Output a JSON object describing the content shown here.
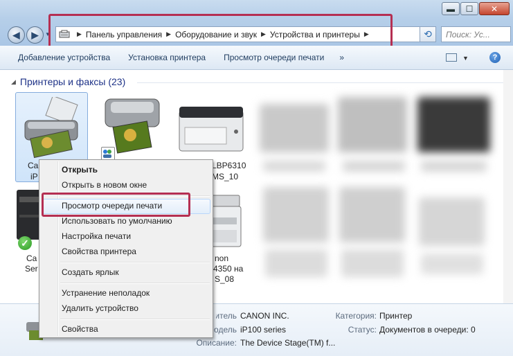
{
  "window": {
    "controls": {
      "minimize": "▬",
      "maximize": "☐",
      "close": "✕"
    }
  },
  "nav": {
    "back_icon": "back-arrow-icon",
    "forward_icon": "forward-arrow-icon"
  },
  "address": {
    "crumbs": [
      "Панель управления",
      "Оборудование и звук",
      "Устройства и принтеры"
    ],
    "dropdown": "▾",
    "refresh": "⟲"
  },
  "search": {
    "placeholder": "Поиск: Ус..."
  },
  "toolbar": {
    "items": [
      "Добавление устройства",
      "Установка принтера",
      "Просмотр очереди печати"
    ],
    "more": "»",
    "view_icon": "view-options-icon",
    "help": "?"
  },
  "section": {
    "title": "Принтеры и факсы (23)"
  },
  "devices": {
    "d1_label_a": "Ca",
    "d1_label_b": "iP",
    "d3_label_a": "LBP6310",
    "d3_label_b": "MS_10",
    "d4_label_a": "Ca",
    "d4_label_b": "Ser",
    "d5_label_a": "non",
    "d5_label_b": "4350 на",
    "d5_label_c": "S_08"
  },
  "context_menu": {
    "open": "Открыть",
    "open_new_window": "Открыть в новом окне",
    "view_queue": "Просмотр очереди печати",
    "set_default": "Использовать по умолчанию",
    "print_settings": "Настройка печати",
    "printer_properties": "Свойства принтера",
    "create_shortcut": "Создать ярлык",
    "troubleshoot": "Устранение неполадок",
    "remove_device": "Удалить устройство",
    "properties": "Свойства"
  },
  "details": {
    "manufacturer_key": "зводитель:",
    "manufacturer_val": "CANON INC.",
    "model_key": "Модель:",
    "model_val": "iP100 series",
    "description_key": "Описание:",
    "description_val": "The Device Stage(TM) f...",
    "category_key": "Категория:",
    "category_val": "Принтер",
    "status_key": "Статус:",
    "status_val": "Документов в очереди: 0"
  },
  "colors": {
    "highlight_red": "#b52f52",
    "title_blue": "#1e3287"
  }
}
